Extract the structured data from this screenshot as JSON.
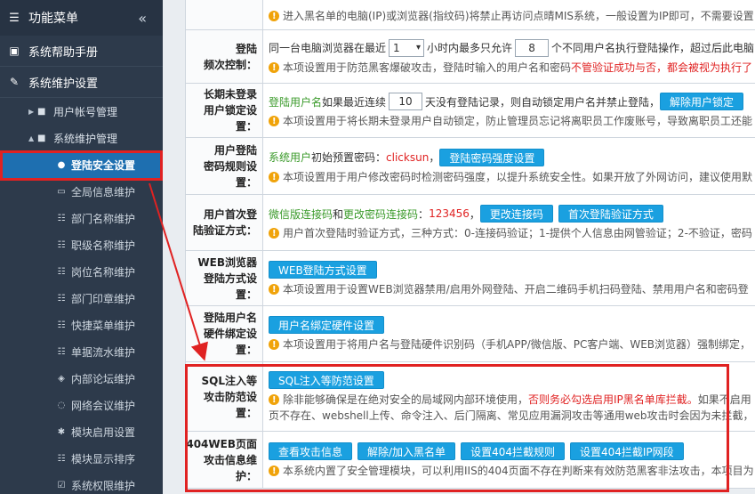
{
  "sidebar": {
    "title": "功能菜单",
    "collapse_label": "«",
    "top_items": [
      {
        "label": "系统帮助手册"
      },
      {
        "label": "系统维护设置"
      }
    ],
    "groups": [
      {
        "label": "用户帐号管理",
        "expanded": false
      },
      {
        "label": "系统维护管理",
        "expanded": true
      }
    ],
    "items": [
      {
        "label": "登陆安全设置",
        "active": true
      },
      {
        "label": "全局信息维护"
      },
      {
        "label": "部门名称维护"
      },
      {
        "label": "职级名称维护"
      },
      {
        "label": "岗位名称维护"
      },
      {
        "label": "部门印章维护"
      },
      {
        "label": "快捷菜单维护"
      },
      {
        "label": "单据流水维护"
      },
      {
        "label": "内部论坛维护"
      },
      {
        "label": "网络会议维护"
      },
      {
        "label": "模块启用设置"
      },
      {
        "label": "模块显示排序"
      },
      {
        "label": "系统权限维护"
      }
    ]
  },
  "rows": {
    "top": {
      "hint": "进入黑名单的电脑(IP)或浏览器(指纹码)将禁止再访问点晴MIS系统，一般设置为IP即可，不需要设置"
    },
    "freq": {
      "label1": "登陆",
      "label2": "频次控制：",
      "t1": "同一台电脑浏览器在最近",
      "select_value": "1",
      "t2": "小时内最多只允许",
      "input_value": "8",
      "t3": "个不同用户名执行登陆操作，超过后此电脑",
      "hint_a": "本项设置用于防范黑客爆破攻击，登陆时输入的用户名和密码",
      "hint_red": "不管验证成功与否，都会被视为执行了",
      "hint_b": ""
    },
    "lock": {
      "label1": "长期未登录",
      "label2": "用户锁定设置：",
      "t_green": "登陆用户名",
      "t1": "如果最近连续",
      "input_value": "10",
      "t2": "天没有登陆记录，则自动锁定用户名并禁止登陆，",
      "button": "解除用户锁定",
      "hint": "本项设置用于将长期未登录用户自动锁定，防止管理员忘记将离职员工作废账号，导致离职员工还能"
    },
    "pwd": {
      "label1": "用户登陆",
      "label2": "密码规则设置：",
      "t_green": "系统用户",
      "t1": "初始预置密码：",
      "t_red": "clicksun",
      "t2": "，",
      "button": "登陆密码强度设置",
      "hint": "本项设置用于用户修改密码时检测密码强度，以提升系统安全性。如果开放了外网访问，建议使用默"
    },
    "first": {
      "label1": "用户首次登",
      "label2": "陆验证方式：",
      "t_green1": "微信版连接码",
      "t1": "和",
      "t_green2": "更改密码连接码",
      "t2": "：",
      "t_red": "123456",
      "t3": "，",
      "button1": "更改连接码",
      "button2": "首次登陆验证方式",
      "hint": "用户首次登陆时验证方式，三种方式：0-连接码验证；1-提供个人信息由网管验证；2-不验证，密码"
    },
    "web": {
      "label1": "WEB浏览器",
      "label2": "登陆方式设置：",
      "button": "WEB登陆方式设置",
      "hint": "本项设置用于设置WEB浏览器禁用/启用外网登陆、开启二维码手机扫码登陆、禁用用户名和密码登"
    },
    "hw": {
      "label1": "登陆用户名",
      "label2": "硬件绑定设置：",
      "button": "用户名绑定硬件设置",
      "hint": "本项设置用于将用户名与登陆硬件识别码（手机APP/微信版、PC客户端、WEB浏览器）强制绑定，"
    },
    "sql": {
      "label1": "SQL注入等",
      "label2": "攻击防范设置：",
      "button": "SQL注入等防范设置",
      "hint_a": "除非能够确保是在绝对安全的局域网内部环境使用，",
      "hint_red": "否则务必勾选启用IP黑名单库拦截。",
      "hint_b": "如果不启用",
      "hint_line2": "页不存在、webshell上传、命令注入、后门隔离、常见应用漏洞攻击等通用web攻击时会因为未拦截，"
    },
    "e404": {
      "label1": "404WEB页面",
      "label2": "攻击信息维护：",
      "buttons": [
        "查看攻击信息",
        "解除/加入黑名单",
        "设置404拦截规则",
        "设置404拦截IP网段"
      ],
      "hint": "本系统内置了安全管理模块，可以利用IIS的404页面不存在判断来有效防范黑客非法攻击，本项目为"
    }
  }
}
